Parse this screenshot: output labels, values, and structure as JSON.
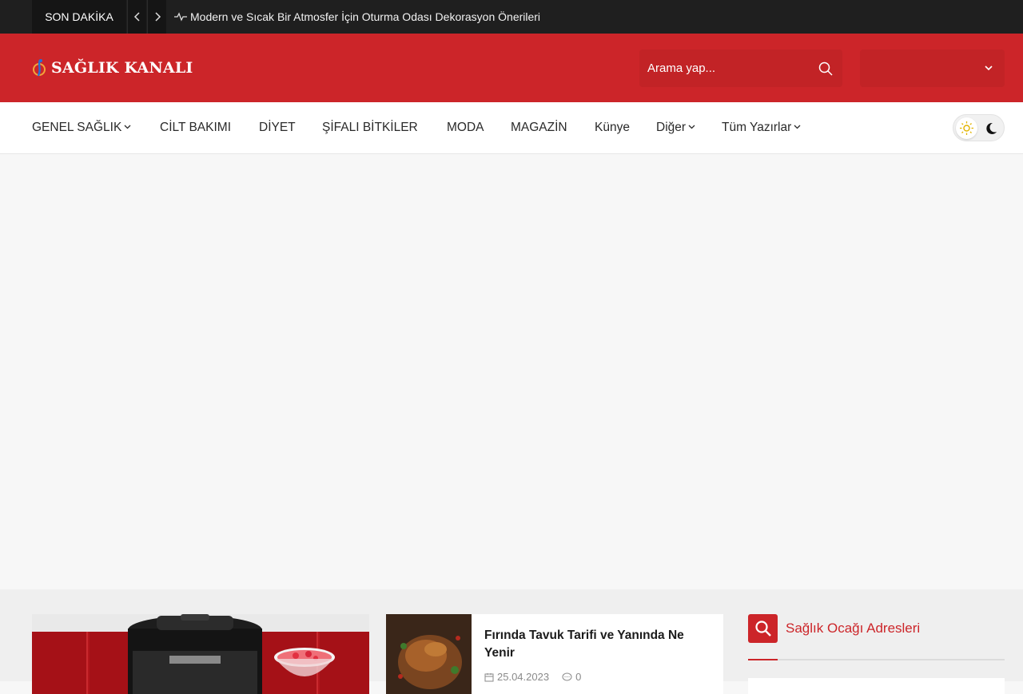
{
  "topbar": {
    "label": "SON DAKİKA",
    "prev_icon": "chevron-left-icon",
    "next_icon": "chevron-right-icon",
    "pulse_icon": "activity-icon",
    "headline": "Modern ve Sıcak Bir Atmosfer İçin Oturma Odası Dekorasyon Önerileri"
  },
  "header": {
    "logo_text": "SAĞLIK KANALI",
    "search_placeholder": "Arama yap...",
    "search_icon": "search-icon",
    "dropdown_icon": "chevron-down-icon",
    "accent_color": "#cc2529"
  },
  "nav": {
    "items": [
      {
        "label": "GENEL SAĞLIK",
        "has_submenu": true
      },
      {
        "label": "CİLT BAKIMI",
        "has_submenu": false
      },
      {
        "label": "DİYET",
        "has_submenu": false
      },
      {
        "label": "ŞİFALI BİTKİLER",
        "has_submenu": false
      },
      {
        "label": "MODA",
        "has_submenu": false
      },
      {
        "label": "MAGAZİN",
        "has_submenu": false
      },
      {
        "label": "Künye",
        "has_submenu": false
      },
      {
        "label": "Diğer",
        "has_submenu": true
      },
      {
        "label": "Tüm Yazırlar",
        "has_submenu": true
      }
    ],
    "theme_toggle": {
      "light_icon": "sun-icon",
      "dark_icon": "moon-icon",
      "active": "light"
    }
  },
  "posts": [
    {
      "title": "Fırında Tavuk Tarifi ve Yanında Ne Yenir",
      "date": "25.04.2023",
      "comments": "0"
    }
  ],
  "sidebar": {
    "widget_title": "Sağlık Ocağı Adresleri",
    "widget_icon": "search-icon"
  }
}
